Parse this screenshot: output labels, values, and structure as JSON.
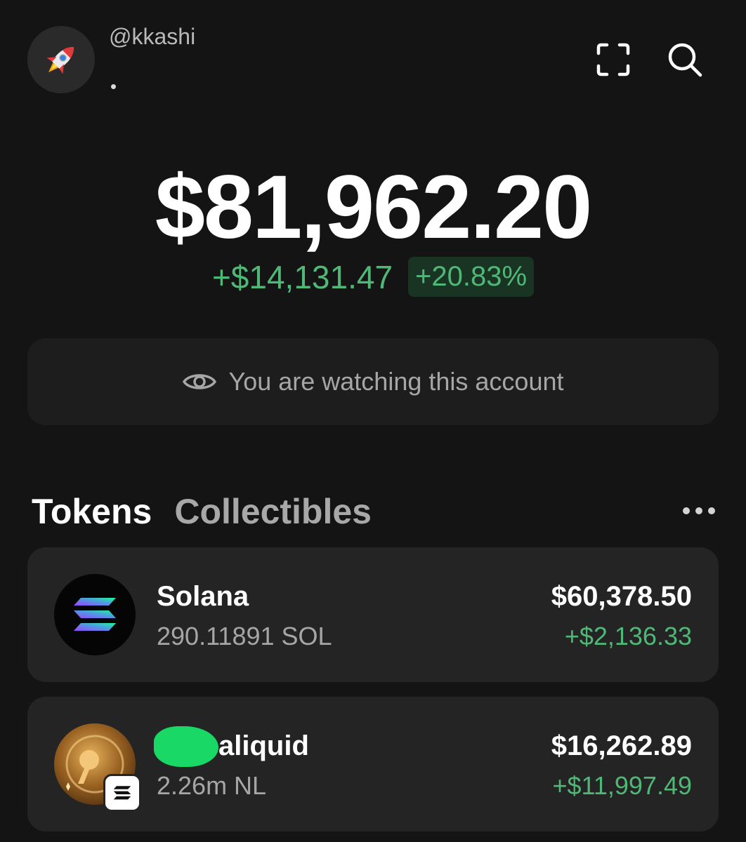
{
  "header": {
    "username": "@kkashi",
    "avatar_icon": "rocket-icon",
    "scan_icon": "scan-frame-icon",
    "search_icon": "search-icon"
  },
  "portfolio": {
    "balance": "$81,962.20",
    "change_amount": "+$14,131.47",
    "change_percent": "+20.83%"
  },
  "watch_banner": {
    "icon": "eye-icon",
    "text": "You are watching this account"
  },
  "tabs": [
    {
      "label": "Tokens",
      "active": true
    },
    {
      "label": "Collectibles",
      "active": false
    }
  ],
  "more_icon": "more-horizontal-icon",
  "tokens": [
    {
      "name": "Solana",
      "quantity": "290.11891 SOL",
      "value": "$60,378.50",
      "change": "+$2,136.33",
      "icon": "solana-icon"
    },
    {
      "name": "aliquid",
      "quantity": "2.26m NL",
      "value": "$16,262.89",
      "change": "+$11,997.49",
      "icon": "token-logo-icon"
    }
  ],
  "colors": {
    "background": "#141414",
    "card": "#242424",
    "positive": "#4fb877",
    "positive_badge_bg": "#1a3424"
  }
}
